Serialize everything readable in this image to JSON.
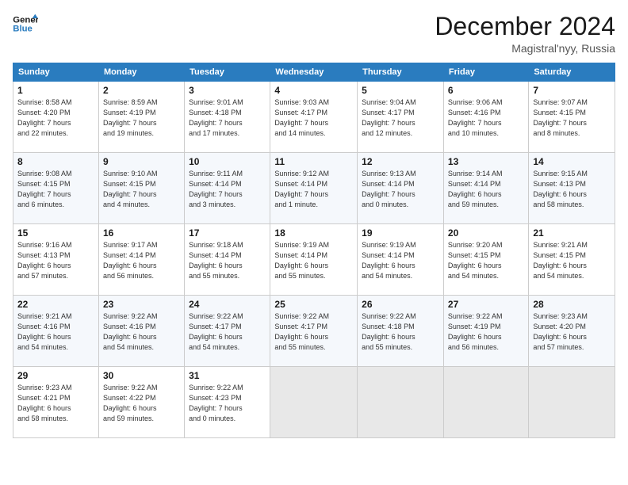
{
  "header": {
    "logo_line1": "General",
    "logo_line2": "Blue",
    "month_title": "December 2024",
    "location": "Magistral'nyy, Russia"
  },
  "weekdays": [
    "Sunday",
    "Monday",
    "Tuesday",
    "Wednesday",
    "Thursday",
    "Friday",
    "Saturday"
  ],
  "weeks": [
    [
      {
        "day": "1",
        "lines": [
          "Sunrise: 8:58 AM",
          "Sunset: 4:20 PM",
          "Daylight: 7 hours",
          "and 22 minutes."
        ]
      },
      {
        "day": "2",
        "lines": [
          "Sunrise: 8:59 AM",
          "Sunset: 4:19 PM",
          "Daylight: 7 hours",
          "and 19 minutes."
        ]
      },
      {
        "day": "3",
        "lines": [
          "Sunrise: 9:01 AM",
          "Sunset: 4:18 PM",
          "Daylight: 7 hours",
          "and 17 minutes."
        ]
      },
      {
        "day": "4",
        "lines": [
          "Sunrise: 9:03 AM",
          "Sunset: 4:17 PM",
          "Daylight: 7 hours",
          "and 14 minutes."
        ]
      },
      {
        "day": "5",
        "lines": [
          "Sunrise: 9:04 AM",
          "Sunset: 4:17 PM",
          "Daylight: 7 hours",
          "and 12 minutes."
        ]
      },
      {
        "day": "6",
        "lines": [
          "Sunrise: 9:06 AM",
          "Sunset: 4:16 PM",
          "Daylight: 7 hours",
          "and 10 minutes."
        ]
      },
      {
        "day": "7",
        "lines": [
          "Sunrise: 9:07 AM",
          "Sunset: 4:15 PM",
          "Daylight: 7 hours",
          "and 8 minutes."
        ]
      }
    ],
    [
      {
        "day": "8",
        "lines": [
          "Sunrise: 9:08 AM",
          "Sunset: 4:15 PM",
          "Daylight: 7 hours",
          "and 6 minutes."
        ]
      },
      {
        "day": "9",
        "lines": [
          "Sunrise: 9:10 AM",
          "Sunset: 4:15 PM",
          "Daylight: 7 hours",
          "and 4 minutes."
        ]
      },
      {
        "day": "10",
        "lines": [
          "Sunrise: 9:11 AM",
          "Sunset: 4:14 PM",
          "Daylight: 7 hours",
          "and 3 minutes."
        ]
      },
      {
        "day": "11",
        "lines": [
          "Sunrise: 9:12 AM",
          "Sunset: 4:14 PM",
          "Daylight: 7 hours",
          "and 1 minute."
        ]
      },
      {
        "day": "12",
        "lines": [
          "Sunrise: 9:13 AM",
          "Sunset: 4:14 PM",
          "Daylight: 7 hours",
          "and 0 minutes."
        ]
      },
      {
        "day": "13",
        "lines": [
          "Sunrise: 9:14 AM",
          "Sunset: 4:14 PM",
          "Daylight: 6 hours",
          "and 59 minutes."
        ]
      },
      {
        "day": "14",
        "lines": [
          "Sunrise: 9:15 AM",
          "Sunset: 4:13 PM",
          "Daylight: 6 hours",
          "and 58 minutes."
        ]
      }
    ],
    [
      {
        "day": "15",
        "lines": [
          "Sunrise: 9:16 AM",
          "Sunset: 4:13 PM",
          "Daylight: 6 hours",
          "and 57 minutes."
        ]
      },
      {
        "day": "16",
        "lines": [
          "Sunrise: 9:17 AM",
          "Sunset: 4:14 PM",
          "Daylight: 6 hours",
          "and 56 minutes."
        ]
      },
      {
        "day": "17",
        "lines": [
          "Sunrise: 9:18 AM",
          "Sunset: 4:14 PM",
          "Daylight: 6 hours",
          "and 55 minutes."
        ]
      },
      {
        "day": "18",
        "lines": [
          "Sunrise: 9:19 AM",
          "Sunset: 4:14 PM",
          "Daylight: 6 hours",
          "and 55 minutes."
        ]
      },
      {
        "day": "19",
        "lines": [
          "Sunrise: 9:19 AM",
          "Sunset: 4:14 PM",
          "Daylight: 6 hours",
          "and 54 minutes."
        ]
      },
      {
        "day": "20",
        "lines": [
          "Sunrise: 9:20 AM",
          "Sunset: 4:15 PM",
          "Daylight: 6 hours",
          "and 54 minutes."
        ]
      },
      {
        "day": "21",
        "lines": [
          "Sunrise: 9:21 AM",
          "Sunset: 4:15 PM",
          "Daylight: 6 hours",
          "and 54 minutes."
        ]
      }
    ],
    [
      {
        "day": "22",
        "lines": [
          "Sunrise: 9:21 AM",
          "Sunset: 4:16 PM",
          "Daylight: 6 hours",
          "and 54 minutes."
        ]
      },
      {
        "day": "23",
        "lines": [
          "Sunrise: 9:22 AM",
          "Sunset: 4:16 PM",
          "Daylight: 6 hours",
          "and 54 minutes."
        ]
      },
      {
        "day": "24",
        "lines": [
          "Sunrise: 9:22 AM",
          "Sunset: 4:17 PM",
          "Daylight: 6 hours",
          "and 54 minutes."
        ]
      },
      {
        "day": "25",
        "lines": [
          "Sunrise: 9:22 AM",
          "Sunset: 4:17 PM",
          "Daylight: 6 hours",
          "and 55 minutes."
        ]
      },
      {
        "day": "26",
        "lines": [
          "Sunrise: 9:22 AM",
          "Sunset: 4:18 PM",
          "Daylight: 6 hours",
          "and 55 minutes."
        ]
      },
      {
        "day": "27",
        "lines": [
          "Sunrise: 9:22 AM",
          "Sunset: 4:19 PM",
          "Daylight: 6 hours",
          "and 56 minutes."
        ]
      },
      {
        "day": "28",
        "lines": [
          "Sunrise: 9:23 AM",
          "Sunset: 4:20 PM",
          "Daylight: 6 hours",
          "and 57 minutes."
        ]
      }
    ],
    [
      {
        "day": "29",
        "lines": [
          "Sunrise: 9:23 AM",
          "Sunset: 4:21 PM",
          "Daylight: 6 hours",
          "and 58 minutes."
        ]
      },
      {
        "day": "30",
        "lines": [
          "Sunrise: 9:22 AM",
          "Sunset: 4:22 PM",
          "Daylight: 6 hours",
          "and 59 minutes."
        ]
      },
      {
        "day": "31",
        "lines": [
          "Sunrise: 9:22 AM",
          "Sunset: 4:23 PM",
          "Daylight: 7 hours",
          "and 0 minutes."
        ]
      },
      null,
      null,
      null,
      null
    ]
  ]
}
